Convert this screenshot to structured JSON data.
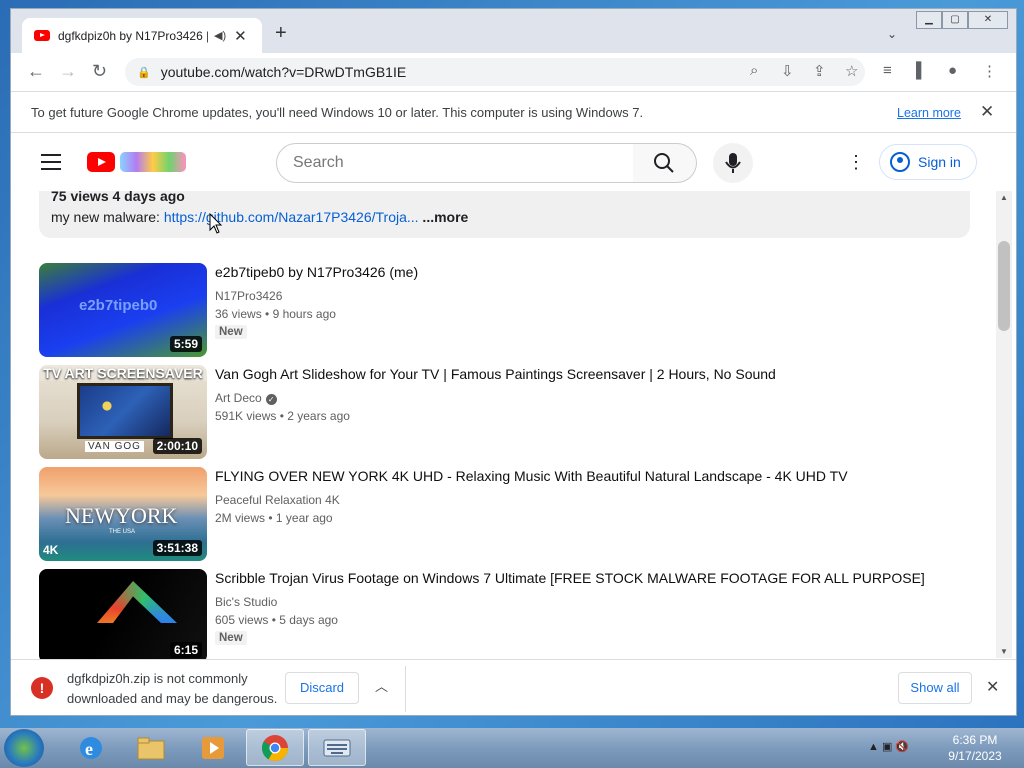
{
  "browser": {
    "tab": {
      "title": "dgfkdpiz0h by N17Pro3426 |",
      "audio_icon": "speaker-icon",
      "close": "✕"
    },
    "new_tab": "+",
    "url": "youtube.com/watch?v=DRwDTmGB1IE",
    "window_controls": {
      "minimize": "▁",
      "maximize": "▢",
      "close": "✕"
    },
    "tab_search": "⌄"
  },
  "infobar": {
    "message": "To get future Google Chrome updates, you'll need Windows 10 or later. This computer is using Windows 7.",
    "learn_more": "Learn more",
    "close": "✕"
  },
  "youtube": {
    "search_placeholder": "Search",
    "sign_in": "Sign in",
    "menu_more": "⋮"
  },
  "description": {
    "meta": "75 views  4 days ago",
    "prefix": "my new malware: ",
    "link": "https://github.com/Nazar17P3426/Troja...",
    "more": " ...more"
  },
  "videos": [
    {
      "title": "e2b7tipeb0 by N17Pro3426 (me)",
      "channel": "N17Pro3426",
      "views": "36 views",
      "age": "9 hours ago",
      "badge": "New",
      "duration": "5:59",
      "thumb_text": "e2b7tipeb0",
      "verified": false
    },
    {
      "title": "Van Gogh Art Slideshow for Your TV | Famous Paintings Screensaver | 2 Hours, No Sound",
      "channel": "Art Deco",
      "views": "591K views",
      "age": "2 years ago",
      "badge": "",
      "duration": "2:00:10",
      "thumb_text": "TV ART SCREENSAVER",
      "thumb_text2": "VAN GOG",
      "verified": true
    },
    {
      "title": "FLYING OVER NEW YORK 4K UHD - Relaxing Music With Beautiful Natural Landscape - 4K UHD TV",
      "channel": "Peaceful Relaxation 4K",
      "views": "2M views",
      "age": "1 year ago",
      "badge": "",
      "duration": "3:51:38",
      "thumb_text": "NEWYORK",
      "thumb_text2": "THE USA",
      "thumb_text3": "4K",
      "verified": false
    },
    {
      "title": "Scribble Trojan Virus Footage on Windows 7 Ultimate [FREE STOCK MALWARE FOOTAGE FOR ALL PURPOSE]",
      "channel": "Bic's Studio",
      "views": "605 views",
      "age": "5 days ago",
      "badge": "New",
      "duration": "6:15",
      "verified": false
    }
  ],
  "download": {
    "line1": "dgfkdpiz0h.zip is not commonly",
    "line2": "downloaded and may be dangerous.",
    "discard": "Discard",
    "show_all": "Show all",
    "close": "✕"
  },
  "taskbar": {
    "time": "6:36 PM",
    "date": "9/17/2023"
  }
}
